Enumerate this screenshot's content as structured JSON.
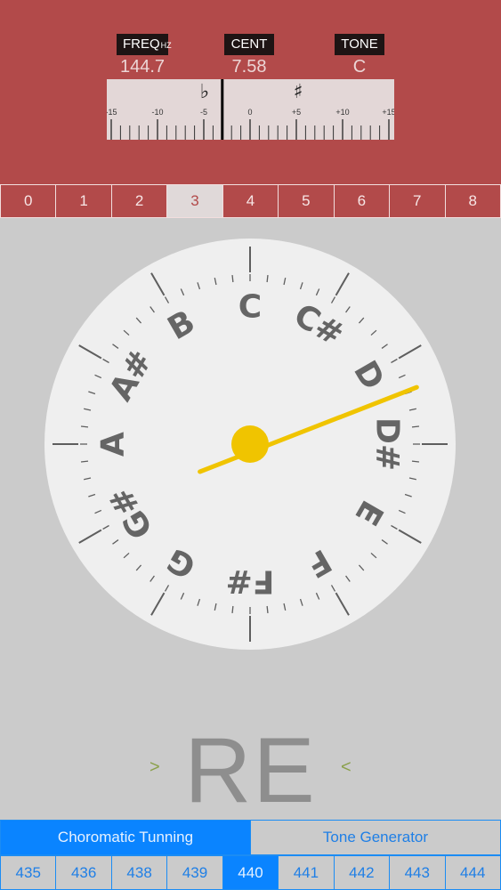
{
  "header": {
    "freq_label": "FREQ",
    "freq_unit": "HZ",
    "cent_label": "CENT",
    "tone_label": "TONE",
    "freq_value": "144.7",
    "cent_value": "7.58",
    "tone_value": "C"
  },
  "meter": {
    "flat_symbol": "♭",
    "sharp_symbol": "♯",
    "tick_labels": [
      "-15",
      "-10",
      "-5",
      "0",
      "+5",
      "+10",
      "+15"
    ],
    "needle_cents": -3
  },
  "octaves": {
    "items": [
      "0",
      "1",
      "2",
      "3",
      "4",
      "5",
      "6",
      "7",
      "8"
    ],
    "selected": 3
  },
  "dial": {
    "notes": [
      "C",
      "C#",
      "D",
      "D#",
      "E",
      "F",
      "F#",
      "G",
      "G#",
      "A",
      "A#",
      "B"
    ],
    "needle_position_notes": 2.0,
    "colors": {
      "needle": "#f0c400",
      "face": "#efefef",
      "text": "#656565"
    }
  },
  "note_display": {
    "name": "RE",
    "left_arrow": ">",
    "right_arrow": "<"
  },
  "modes": {
    "items": [
      "Choromatic Tunning",
      "Tone Generator"
    ],
    "active": 0
  },
  "pitch": {
    "items": [
      "435",
      "436",
      "438",
      "439",
      "440",
      "441",
      "442",
      "443",
      "444"
    ],
    "selected": 4
  },
  "colors": {
    "header": "#b24a4a",
    "body": "#cbcbcb",
    "accent": "#0a84ff",
    "arrow": "#8aa04a"
  }
}
